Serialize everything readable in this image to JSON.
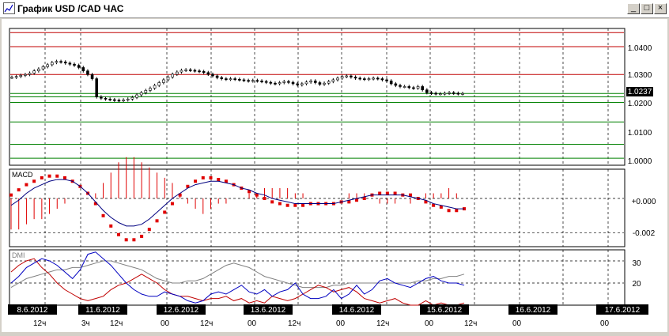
{
  "window": {
    "title": "График USD /CAD  ЧАС",
    "minimize_glyph": "_",
    "maximize_glyph": "□",
    "close_glyph": "×"
  },
  "colors": {
    "price_line_red": "#c00000",
    "support_line_green": "#008000",
    "macd_signal": "#e00000",
    "macd_line": "#000080",
    "dmi_plus": "#0000c0",
    "dmi_minus": "#c00000",
    "adx": "#808080",
    "date_label_bg": "#000000"
  },
  "price_panel": {
    "axis_labels": [
      "1.0400",
      "1.0300",
      "1.0237",
      "1.0200",
      "1.0100",
      "1.0000"
    ],
    "current_price": "1.0237"
  },
  "macd_panel": {
    "label": "MACD",
    "axis_labels": [
      "+0.000",
      "-0.002"
    ]
  },
  "dmi_panel": {
    "label": "DMI",
    "axis_labels": [
      "30",
      "20"
    ]
  },
  "time_axis": {
    "dates": [
      "8.6.2012",
      "11.6.2012",
      "12.6.2012",
      "13.6.2012",
      "14.6.2012",
      "15.6.2012",
      "16.6.2012",
      "17.6.2012"
    ],
    "hours": [
      "12ч",
      "3ч",
      "12ч",
      "00",
      "12ч",
      "00",
      "12ч",
      "00",
      "12ч",
      "00",
      "12ч",
      "00",
      "00",
      "00"
    ]
  },
  "chart_data": [
    {
      "type": "candlestick",
      "title": "",
      "ylim": [
        0.998,
        1.047
      ],
      "reference_lines": [
        1.0455,
        1.0405,
        1.0305,
        1.0237,
        1.0225,
        1.0205,
        1.0135,
        1.0055,
        1.0005
      ],
      "close": [
        1.0295,
        1.0298,
        1.0302,
        1.0305,
        1.031,
        1.0318,
        1.0325,
        1.0333,
        1.034,
        1.0348,
        1.0352,
        1.035,
        1.0346,
        1.0342,
        1.0338,
        1.033,
        1.0318,
        1.0305,
        1.029,
        1.0225,
        1.022,
        1.0217,
        1.0215,
        1.0213,
        1.0212,
        1.0214,
        1.0217,
        1.0223,
        1.0232,
        1.024,
        1.0248,
        1.0256,
        1.0266,
        1.0276,
        1.0286,
        1.0296,
        1.0306,
        1.0314,
        1.032,
        1.0322,
        1.032,
        1.0318,
        1.0316,
        1.0312,
        1.0306,
        1.03,
        1.0294,
        1.029,
        1.0288,
        1.029,
        1.0288,
        1.0286,
        1.0284,
        1.0282,
        1.0284,
        1.0282,
        1.028,
        1.0277,
        1.0274,
        1.0272,
        1.0276,
        1.028,
        1.0277,
        1.0272,
        1.0268,
        1.0272,
        1.0278,
        1.0282,
        1.0276,
        1.027,
        1.0274,
        1.028,
        1.0286,
        1.0292,
        1.0298,
        1.03,
        1.0296,
        1.0292,
        1.029,
        1.0288,
        1.029,
        1.0292,
        1.029,
        1.0286,
        1.0282,
        1.0272,
        1.0266,
        1.0262,
        1.0262,
        1.0258,
        1.0256,
        1.0262,
        1.025,
        1.024,
        1.0238,
        1.0236,
        1.0236,
        1.0238,
        1.024,
        1.0238,
        1.0236,
        1.0237
      ]
    },
    {
      "type": "line",
      "title": "MACD",
      "ylim": [
        -0.0028,
        0.0017
      ],
      "series": [
        {
          "values": [
            0.0002,
            0.0005,
            0.0008,
            0.001,
            0.0012,
            0.0013,
            0.0013,
            0.0012,
            0.001,
            0.0007,
            0.0003,
            -0.0003,
            -0.001,
            -0.0016,
            -0.0021,
            -0.0024,
            -0.0024,
            -0.0022,
            -0.0018,
            -0.0013,
            -0.0008,
            -0.0003,
            0.0002,
            0.0007,
            0.001,
            0.0012,
            0.0012,
            0.0011,
            0.001,
            0.0008,
            0.0006,
            0.0004,
            0.0002,
            0.0,
            -0.0002,
            -0.0003,
            -0.0004,
            -0.0004,
            -0.0004,
            -0.0003,
            -0.0003,
            -0.0003,
            -0.0003,
            -0.0002,
            -0.0002,
            -0.0001,
            0.0,
            0.0002,
            0.0003,
            0.0003,
            0.0003,
            0.0002,
            0.0002,
            0.0,
            -0.0002,
            -0.0004,
            -0.0005,
            -0.0007,
            -0.0007,
            -0.0006
          ]
        },
        {
          "values": [
            -0.0004,
            -0.0001,
            0.0003,
            0.0006,
            0.0008,
            0.001,
            0.0011,
            0.0011,
            0.001,
            0.0007,
            0.0003,
            -0.0002,
            -0.0007,
            -0.0011,
            -0.0014,
            -0.0016,
            -0.0016,
            -0.0015,
            -0.0012,
            -0.0008,
            -0.0004,
            0.0,
            0.0003,
            0.0006,
            0.0008,
            0.0009,
            0.001,
            0.001,
            0.0009,
            0.0008,
            0.0006,
            0.0005,
            0.0003,
            0.0002,
            0.0,
            -0.0001,
            -0.0002,
            -0.0003,
            -0.0003,
            -0.0003,
            -0.0003,
            -0.0003,
            -0.0003,
            -0.0002,
            -0.0001,
            0.0,
            0.0001,
            0.0002,
            0.0002,
            0.0002,
            0.0002,
            0.0002,
            0.0001,
            0.0,
            -0.0001,
            -0.0003,
            -0.0004,
            -0.0005,
            -0.0006,
            -0.0006
          ]
        }
      ]
    },
    {
      "type": "line",
      "title": "DMI",
      "ylim": [
        10,
        35
      ],
      "series": [
        {
          "values": [
            20,
            23,
            27,
            29,
            31,
            30,
            28,
            25,
            22,
            26,
            33,
            34,
            31,
            28,
            24,
            20,
            17,
            15,
            14,
            14,
            16,
            15,
            14,
            12,
            11,
            12,
            15,
            16,
            15,
            17,
            19,
            16,
            15,
            17,
            14,
            16,
            17,
            20,
            15,
            13,
            13,
            14,
            17,
            13,
            15,
            19,
            15,
            17,
            21,
            22,
            20,
            19,
            18,
            20,
            22,
            23,
            21,
            20,
            20,
            19
          ]
        },
        {
          "values": [
            25,
            28,
            30,
            31,
            27,
            24,
            20,
            17,
            15,
            13,
            12,
            13,
            14,
            17,
            19,
            20,
            22,
            24,
            22,
            20,
            17,
            15,
            14,
            14,
            13,
            12,
            13,
            13,
            14,
            12,
            13,
            11,
            12,
            11,
            14,
            13,
            12,
            13,
            15,
            17,
            19,
            18,
            16,
            17,
            18,
            16,
            13,
            12,
            11,
            12,
            13,
            11,
            10,
            10,
            12,
            10,
            11,
            10,
            10,
            11
          ]
        },
        {
          "values": [
            18,
            20,
            22,
            23,
            24,
            25,
            26,
            26,
            27,
            27,
            28,
            29,
            30,
            30,
            29,
            28,
            27,
            26,
            24,
            22,
            21,
            20,
            20,
            21,
            21,
            22,
            24,
            26,
            28,
            29,
            28,
            27,
            25,
            23,
            22,
            21,
            20,
            19,
            18,
            18,
            18,
            18,
            19,
            19,
            20,
            20,
            20,
            20,
            20,
            20,
            20,
            20,
            20,
            21,
            21,
            22,
            22,
            23,
            23,
            24
          ]
        }
      ]
    }
  ]
}
